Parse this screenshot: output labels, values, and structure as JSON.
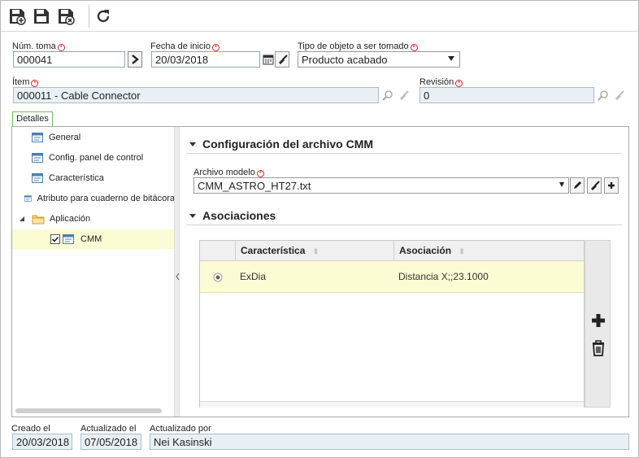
{
  "toolbar": {
    "icons": [
      "save-new-icon",
      "save-icon",
      "save-close-icon",
      "refresh-icon"
    ]
  },
  "form": {
    "num_toma_label": "Núm. toma",
    "num_toma_value": "000041",
    "fecha_label": "Fecha de inicio",
    "fecha_value": "20/03/2018",
    "tipo_label": "Tipo de objeto a ser tomado",
    "tipo_value": "Producto acabado",
    "item_label": "Ítem",
    "item_value": "000011 - Cable Connector",
    "revision_label": "Revisión",
    "revision_value": "0"
  },
  "tabs": {
    "detalles": "Detalles"
  },
  "tree": {
    "items": [
      {
        "label": "General"
      },
      {
        "label": "Config. panel de control"
      },
      {
        "label": "Característica"
      },
      {
        "label": "Atributo para cuaderno de bitácora"
      },
      {
        "label": "Aplicación"
      },
      {
        "label": "CMM"
      }
    ]
  },
  "config": {
    "section_title": "Configuración del archivo CMM",
    "archivo_label": "Archivo modelo",
    "archivo_value": "CMM_ASTRO_HT27.txt"
  },
  "asociaciones": {
    "section_title": "Asociaciones",
    "columns": [
      "Característica",
      "Asociación"
    ],
    "rows": [
      {
        "caracteristica": "ExDia",
        "asociacion": "Distancia X;;23.1000"
      }
    ]
  },
  "footer": {
    "creado_label": "Creado el",
    "creado_value": "20/03/2018",
    "actualizado_label": "Actualizado el",
    "actualizado_value": "07/05/2018",
    "actualizado_por_label": "Actualizado por",
    "actualizado_por_value": "Nei Kasinski"
  },
  "colors": {
    "selected_row": "#fbfbd4",
    "required": "#d22222"
  }
}
